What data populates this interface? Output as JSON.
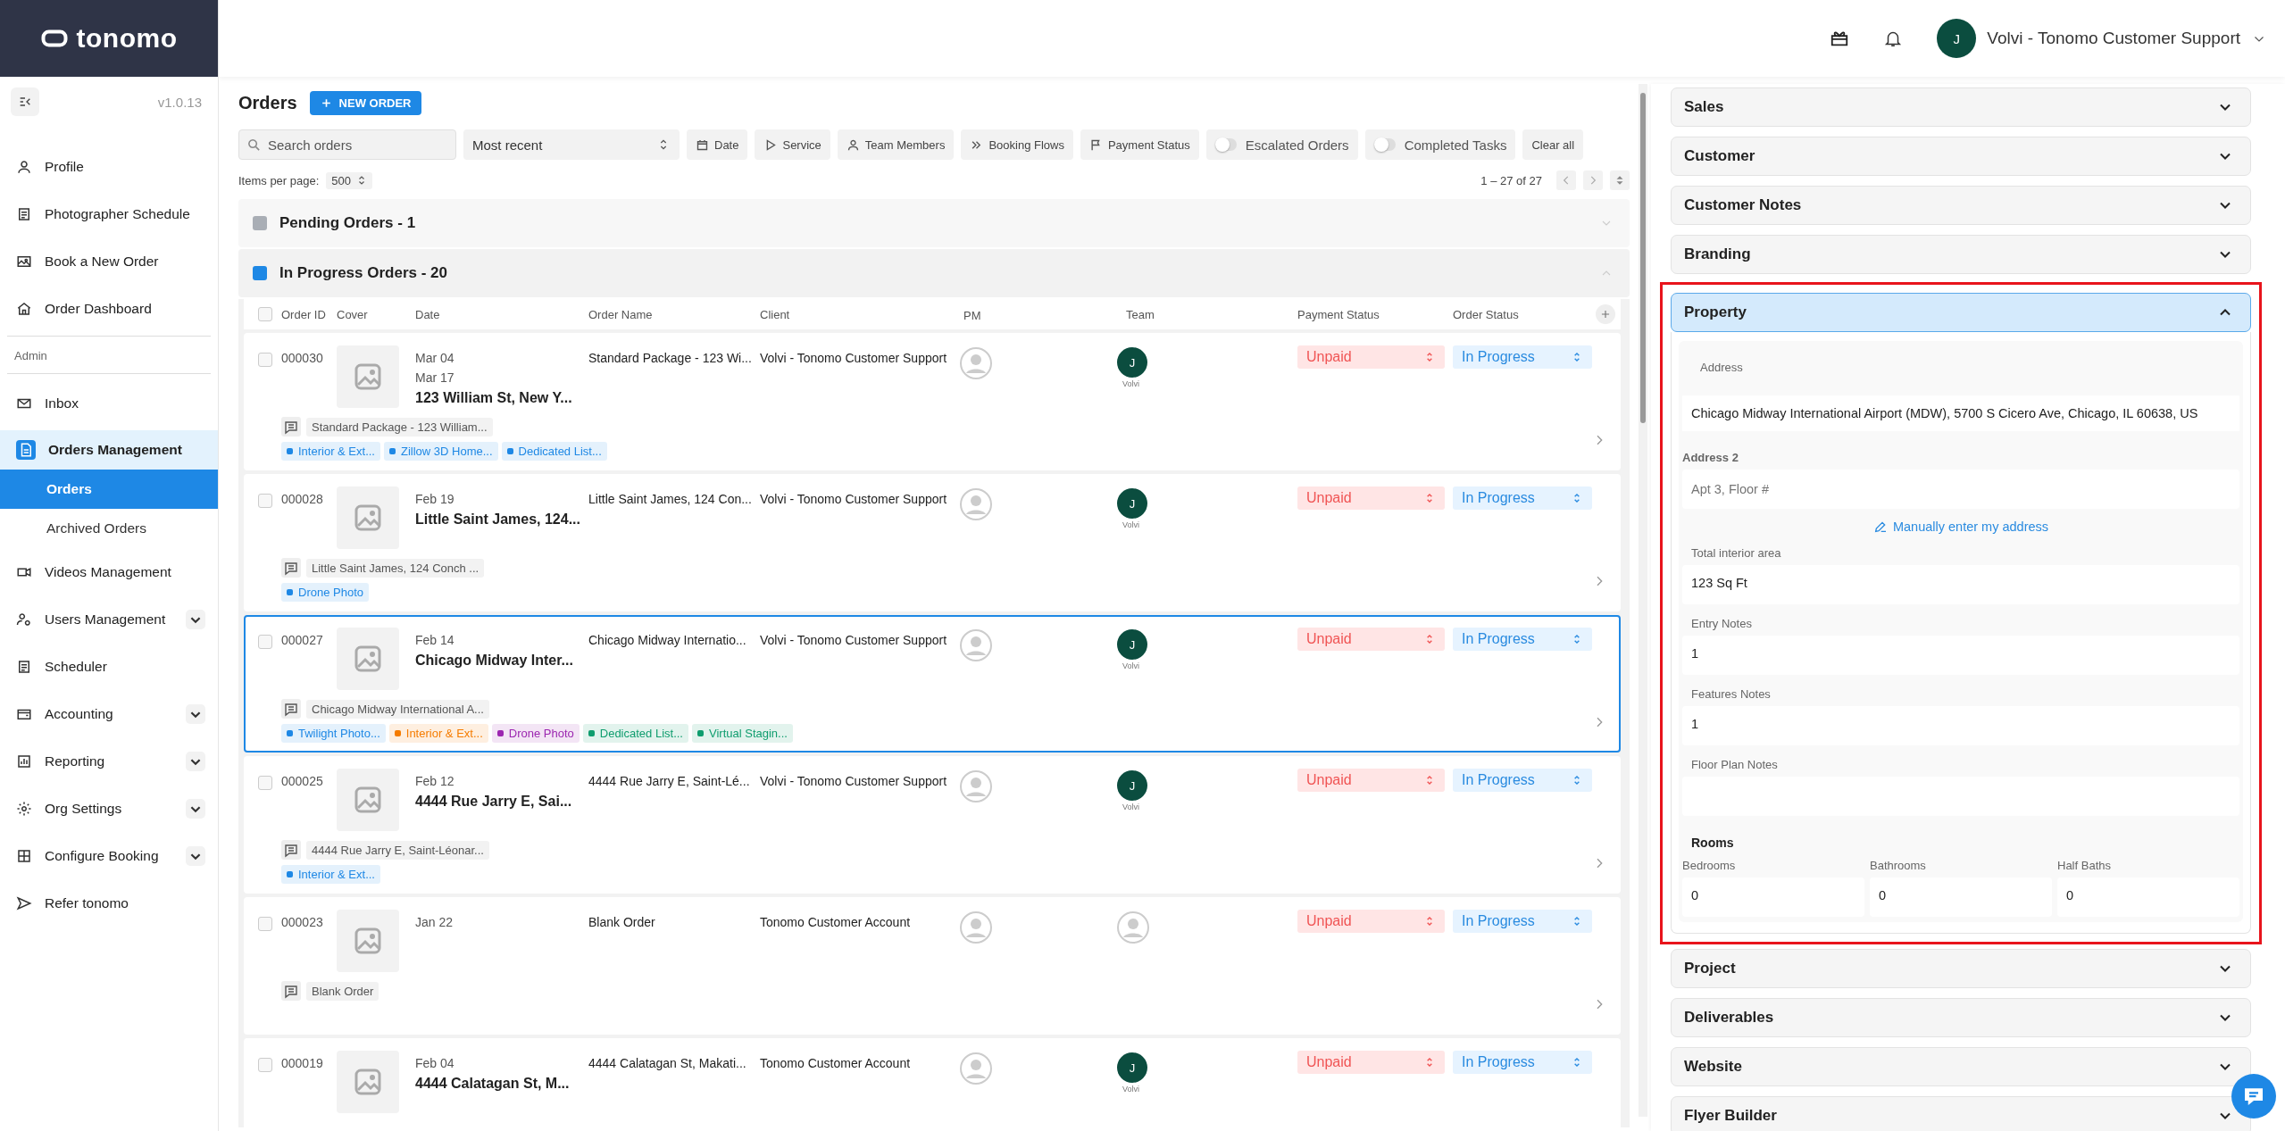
{
  "brand": {
    "logo_text": "tonomo"
  },
  "sidebar": {
    "version": "v1.0.13",
    "items": [
      {
        "label": "Profile",
        "selected": false
      },
      {
        "label": "Photographer Schedule",
        "selected": false
      },
      {
        "label": "Book a New Order",
        "selected": false
      },
      {
        "label": "Order Dashboard",
        "selected": false
      }
    ],
    "section_label": "Admin",
    "admin_items": [
      {
        "label": "Inbox",
        "selected": false
      },
      {
        "label": "Orders Management",
        "selected": false,
        "expanded": true,
        "children": [
          {
            "label": "Orders",
            "selected": true
          },
          {
            "label": "Archived Orders",
            "selected": false
          }
        ]
      },
      {
        "label": "Videos Management",
        "selected": false
      },
      {
        "label": "Users Management",
        "selected": false,
        "expanded": false
      },
      {
        "label": "Scheduler",
        "selected": false
      },
      {
        "label": "Accounting",
        "selected": false,
        "expanded": false
      },
      {
        "label": "Reporting",
        "selected": false,
        "expanded": false
      },
      {
        "label": "Org Settings",
        "selected": false,
        "expanded": false
      },
      {
        "label": "Configure Booking",
        "selected": false,
        "expanded": false
      },
      {
        "label": "Refer tonomo",
        "selected": false
      }
    ]
  },
  "topbar": {
    "user": {
      "initial": "J",
      "name": "Volvi - Tonomo Customer Support"
    }
  },
  "orders": {
    "title": "Orders",
    "new_order_button": "NEW ORDER",
    "search": {
      "placeholder": "Search orders"
    },
    "sort": "Most recent",
    "filters": [
      {
        "kind": "chip",
        "label": "Date"
      },
      {
        "kind": "chip",
        "label": "Service"
      },
      {
        "kind": "chip",
        "label": "Team Members"
      },
      {
        "kind": "chip",
        "label": "Booking Flows"
      },
      {
        "kind": "chip",
        "label": "Payment Status"
      },
      {
        "kind": "toggle",
        "label": "Escalated Orders",
        "on": false
      },
      {
        "kind": "toggle",
        "label": "Completed Tasks",
        "on": false
      }
    ],
    "clear_button": "Clear all",
    "items_per_page_label": "Items per page:",
    "items_per_page": "500",
    "range": "1 – 27 of 27",
    "groups": [
      {
        "title": "Pending Orders - 1",
        "color": "#a9aeb5",
        "expanded": false
      },
      {
        "title": "In Progress Orders - 20",
        "color": "#1e88e5",
        "expanded": true
      }
    ],
    "select_all_checked": false,
    "columns": [
      "Order ID",
      "Cover",
      "Date",
      "Order Name",
      "Client",
      "PM",
      "Team",
      "Payment Status",
      "Order Status"
    ],
    "rows": [
      {
        "id": "000030",
        "dates": [
          "Mar 04",
          "Mar 17"
        ],
        "title": "123 William St, New Y...",
        "order_name": "Standard Package - 123 Wi...",
        "client": "Volvi - Tonomo Customer Support",
        "team": {
          "initial": "J",
          "name": "Volvi"
        },
        "payment": "Unpaid",
        "status": "In Progress",
        "note": "Standard Package - 123 William...",
        "tags": [
          {
            "label": "Interior & Ext...",
            "color": "#1e88e5"
          },
          {
            "label": "Zillow 3D Home...",
            "color": "#1e88e5"
          },
          {
            "label": "Dedicated List...",
            "color": "#1e88e5"
          }
        ],
        "checked": false,
        "selected": false
      },
      {
        "id": "000028",
        "dates": [
          "Feb 19"
        ],
        "title": "Little Saint James, 124...",
        "order_name": "Little Saint James, 124 Con...",
        "client": "Volvi - Tonomo Customer Support",
        "team": {
          "initial": "J",
          "name": "Volvi"
        },
        "payment": "Unpaid",
        "status": "In Progress",
        "note": "Little Saint James, 124 Conch ...",
        "tags": [
          {
            "label": "Drone Photo",
            "color": "#1e88e5"
          }
        ],
        "checked": false,
        "selected": false
      },
      {
        "id": "000027",
        "dates": [
          "Feb 14"
        ],
        "title": "Chicago Midway Inter...",
        "order_name": "Chicago Midway Internatio...",
        "client": "Volvi - Tonomo Customer Support",
        "team": {
          "initial": "J",
          "name": "Volvi"
        },
        "payment": "Unpaid",
        "status": "In Progress",
        "note": "Chicago Midway International A...",
        "tags": [
          {
            "label": "Twilight Photo...",
            "color": "#1e88e5"
          },
          {
            "label": "Interior & Ext...",
            "color": "#f57c00"
          },
          {
            "label": "Drone Photo",
            "color": "#9c27b0"
          },
          {
            "label": "Dedicated List...",
            "color": "#0f9d6e"
          },
          {
            "label": "Virtual Stagin...",
            "color": "#0f9d6e"
          }
        ],
        "checked": false,
        "selected": true
      },
      {
        "id": "000025",
        "dates": [
          "Feb 12"
        ],
        "title": "4444 Rue Jarry E, Sai...",
        "order_name": "4444 Rue Jarry E, Saint-Lé...",
        "client": "Volvi - Tonomo Customer Support",
        "team": {
          "initial": "J",
          "name": "Volvi"
        },
        "payment": "Unpaid",
        "status": "In Progress",
        "note": "4444 Rue Jarry E, Saint-Léonar...",
        "tags": [
          {
            "label": "Interior & Ext...",
            "color": "#1e88e5"
          }
        ],
        "checked": false,
        "selected": false
      },
      {
        "id": "000023",
        "dates": [
          "Jan 22"
        ],
        "order_name": "Blank Order",
        "client": "Tonomo Customer Account",
        "payment": "Unpaid",
        "status": "In Progress",
        "note": "Blank Order",
        "checked": false,
        "selected": false
      },
      {
        "id": "000019",
        "dates": [
          "Feb 04"
        ],
        "title": "4444 Calatagan St, M...",
        "order_name": "4444 Calatagan St, Makati...",
        "client": "Tonomo Customer Account",
        "team": {
          "initial": "J",
          "name": "Volvi"
        },
        "payment": "Unpaid",
        "status": "In Progress",
        "checked": false,
        "selected": false
      }
    ]
  },
  "panel": {
    "sections": [
      {
        "title": "Sales",
        "expanded": false
      },
      {
        "title": "Customer",
        "expanded": false
      },
      {
        "title": "Customer Notes",
        "expanded": false
      },
      {
        "title": "Branding",
        "expanded": false
      },
      {
        "title": "Property",
        "expanded": true,
        "highlighted": true,
        "address": {
          "label": "Address",
          "value": "Chicago Midway International Airport (MDW), 5700 S Cicero Ave, Chicago, IL 60638, US"
        },
        "address2": {
          "label": "Address 2",
          "placeholder": "Apt 3, Floor #"
        },
        "manual_link": "Manually enter my address",
        "fields": [
          {
            "label": "Total interior area",
            "value": "123 Sq Ft"
          },
          {
            "label": "Entry Notes",
            "value": "1"
          },
          {
            "label": "Features Notes",
            "value": "1"
          },
          {
            "label": "Floor Plan Notes"
          }
        ],
        "rooms": {
          "title": "Rooms",
          "fields": [
            {
              "label": "Bedrooms",
              "value": "0"
            },
            {
              "label": "Bathrooms",
              "value": "0"
            },
            {
              "label": "Half Baths",
              "value": "0"
            }
          ]
        }
      },
      {
        "title": "Project",
        "expanded": false
      },
      {
        "title": "Deliverables",
        "expanded": false
      },
      {
        "title": "Website",
        "expanded": false
      },
      {
        "title": "Flyer Builder",
        "expanded": false
      }
    ]
  }
}
